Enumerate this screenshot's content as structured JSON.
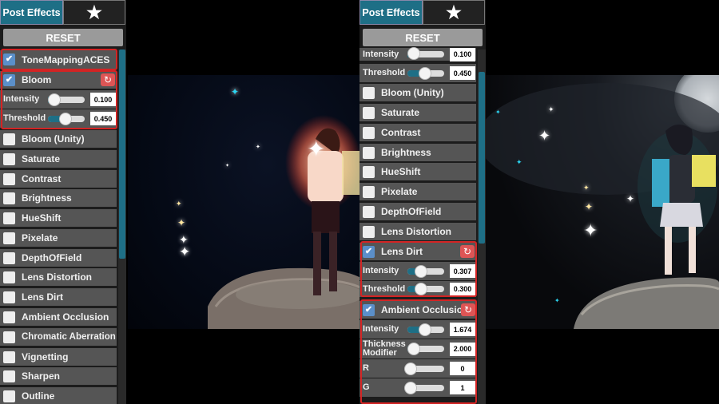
{
  "tabs": {
    "active_label": "Post Effects",
    "favorites_label": "★"
  },
  "reset_label": "RESET",
  "left": {
    "rows": [
      {
        "label": "ToneMappingACES",
        "checked": true
      },
      {
        "label": "Bloom",
        "checked": true,
        "expanded": true,
        "params": [
          {
            "label": "Intensity",
            "value": "0.100",
            "level": 0.05
          },
          {
            "label": "Threshold",
            "value": "0.450",
            "level": 0.45
          }
        ]
      },
      {
        "label": "Bloom (Unity)",
        "checked": false
      },
      {
        "label": "Saturate",
        "checked": false
      },
      {
        "label": "Contrast",
        "checked": false
      },
      {
        "label": "Brightness",
        "checked": false
      },
      {
        "label": "HueShift",
        "checked": false
      },
      {
        "label": "Pixelate",
        "checked": false
      },
      {
        "label": "DepthOfField",
        "checked": false
      },
      {
        "label": "Lens Distortion",
        "checked": false
      },
      {
        "label": "Lens Dirt",
        "checked": false
      },
      {
        "label": "Ambient Occlusion",
        "checked": false
      },
      {
        "label": "Chromatic Aberration",
        "checked": false
      },
      {
        "label": "Vignetting",
        "checked": false
      },
      {
        "label": "Sharpen",
        "checked": false
      },
      {
        "label": "Outline",
        "checked": false
      }
    ]
  },
  "right": {
    "bloom_params": [
      {
        "label": "Intensity",
        "value": "0.100",
        "level": 0.05
      },
      {
        "label": "Threshold",
        "value": "0.450",
        "level": 0.45
      }
    ],
    "rows": [
      {
        "label": "Bloom (Unity)",
        "checked": false
      },
      {
        "label": "Saturate",
        "checked": false
      },
      {
        "label": "Contrast",
        "checked": false
      },
      {
        "label": "Brightness",
        "checked": false
      },
      {
        "label": "HueShift",
        "checked": false
      },
      {
        "label": "Pixelate",
        "checked": false
      },
      {
        "label": "DepthOfField",
        "checked": false
      },
      {
        "label": "Lens Distortion",
        "checked": false
      }
    ],
    "lens_dirt": {
      "label": "Lens Dirt",
      "checked": true,
      "params": [
        {
          "label": "Intensity",
          "value": "0.307",
          "level": 0.31
        },
        {
          "label": "Threshold",
          "value": "0.300",
          "level": 0.3
        }
      ]
    },
    "ambient_occlusion": {
      "label": "Ambient Occlusio",
      "checked": true,
      "params": [
        {
          "label": "Intensity",
          "value": "1.674",
          "level": 0.42
        },
        {
          "label": "Thickness Modifier",
          "value": "2.000",
          "level": 0.1
        },
        {
          "label": "R",
          "value": "0",
          "level": 0
        },
        {
          "label": "G",
          "value": "1",
          "level": 0
        }
      ]
    }
  },
  "colors": {
    "accent": "#1e6f86",
    "highlight": "#d32424",
    "row": "#555555",
    "checkbox_checked": "#5b8fc9"
  },
  "icons": [
    "star-icon",
    "checkmark-icon",
    "reset-icon",
    "sparkle-icon"
  ]
}
